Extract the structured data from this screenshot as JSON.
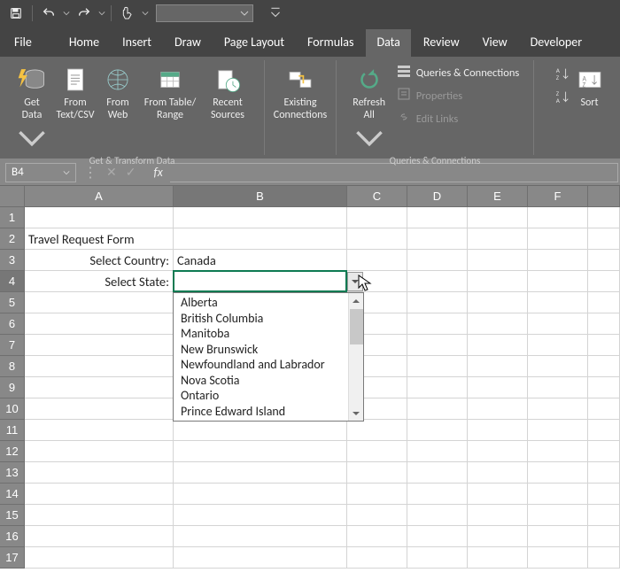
{
  "qat": {
    "save": "save-icon",
    "undo": "undo-icon",
    "redo": "redo-icon",
    "touch": "touch-icon"
  },
  "tabs": [
    "File",
    "Home",
    "Insert",
    "Draw",
    "Page Layout",
    "Formulas",
    "Data",
    "Review",
    "View",
    "Developer"
  ],
  "active_tab_index": 6,
  "ribbon": {
    "group1_label": "Get & Transform Data",
    "btn_get_data": "Get\nData",
    "btn_from_textcsv": "From\nText/CSV",
    "btn_from_web": "From\nWeb",
    "btn_from_table": "From Table/\nRange",
    "btn_recent": "Recent\nSources",
    "btn_existing": "Existing\nConnections",
    "btn_refresh": "Refresh\nAll",
    "queries_conn": "Queries & Connections",
    "properties": "Properties",
    "edit_links": "Edit Links",
    "group2_label": "Queries & Connections",
    "sort": "Sort"
  },
  "namebox": "B4",
  "fx_label": "fx",
  "columns": [
    "A",
    "B",
    "C",
    "D",
    "E",
    "F"
  ],
  "active_col_index": 1,
  "active_row": 4,
  "row_count": 17,
  "cells": {
    "A2": "Travel Request Form",
    "A3": "Select Country:",
    "B3": "Canada",
    "A4": "Select State:"
  },
  "dropdown": {
    "items": [
      "Alberta",
      "British Columbia",
      "Manitoba",
      "New Brunswick",
      "Newfoundland and Labrador",
      "Nova Scotia",
      "Ontario",
      "Prince Edward Island"
    ]
  }
}
